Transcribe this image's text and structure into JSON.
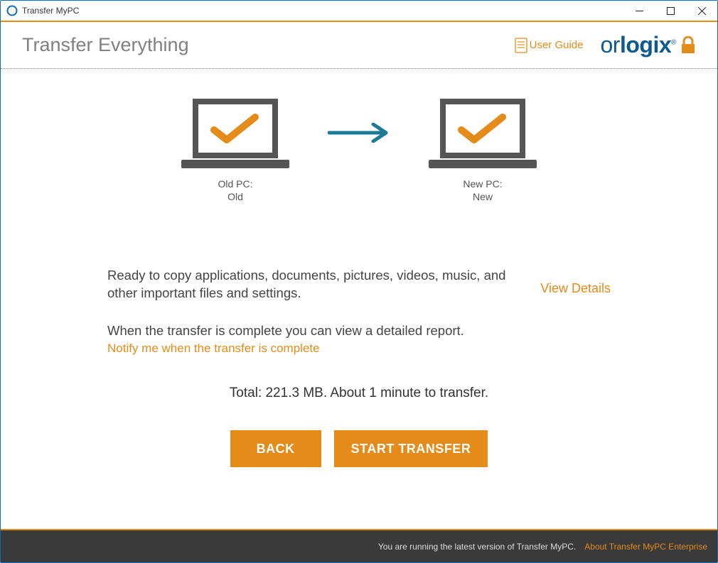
{
  "window": {
    "title": "Transfer MyPC"
  },
  "header": {
    "title": "Transfer Everything",
    "user_guide": "User Guide",
    "brand": "orlogix"
  },
  "pcs": {
    "old_label": "Old PC:",
    "old_name": "Old",
    "new_label": "New PC:",
    "new_name": "New"
  },
  "body": {
    "ready": "Ready to copy applications, documents, pictures, videos, music, and other important files and settings.",
    "view_details": "View Details",
    "complete": "When the transfer is complete you can view a detailed report.",
    "notify": "Notify me when the transfer is complete",
    "total": "Total: 221.3 MB.  About 1 minute to transfer."
  },
  "buttons": {
    "back": "BACK",
    "start": "START TRANSFER"
  },
  "footer": {
    "version": "You are running the latest version of Transfer MyPC.",
    "link": "About Transfer MyPC Enterprise"
  }
}
